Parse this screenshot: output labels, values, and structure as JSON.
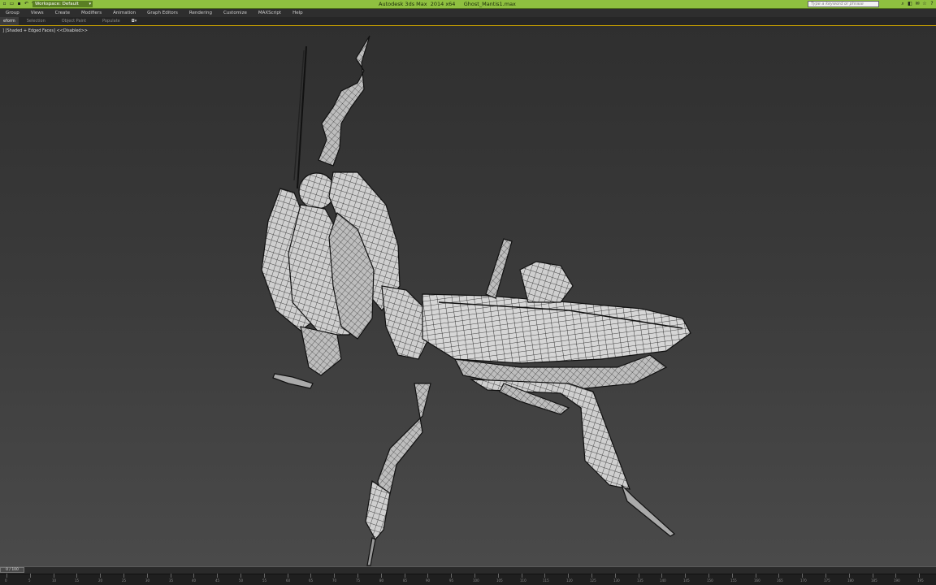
{
  "titlebar": {
    "workspace": "Workspace: Default",
    "app_title": "Autodesk 3ds Max  2014 x64     Ghost_Mantis1.max",
    "search_placeholder": "Type a keyword or phrase",
    "accent": "#8fc040"
  },
  "quick_access": [
    "new-file-icon",
    "open-icon",
    "save-icon",
    "undo-icon",
    "redo-icon",
    "project-icon"
  ],
  "titlebar_icons": [
    "search-icon",
    "subscription-icon",
    "communication-icon",
    "favorites-icon",
    "help-icon"
  ],
  "menu": [
    "Group",
    "Views",
    "Create",
    "Modifiers",
    "Animation",
    "Graph Editors",
    "Rendering",
    "Customize",
    "MAXScript",
    "Help"
  ],
  "ribbon": {
    "tabs": [
      "eform",
      "Selection",
      "Object Paint",
      "Populate"
    ]
  },
  "viewport": {
    "label": "] [Shaded + Edged Faces]  <<Disabled>>"
  },
  "timeline": {
    "slider": "0 / 100",
    "ticks": [
      "0",
      "5",
      "10",
      "15",
      "20",
      "25",
      "30",
      "35",
      "40",
      "45",
      "50",
      "55",
      "60",
      "65",
      "70",
      "75",
      "80",
      "85",
      "90",
      "95",
      "100",
      "105",
      "110",
      "115",
      "120",
      "125",
      "130",
      "135",
      "140",
      "145",
      "150",
      "155",
      "160",
      "165",
      "170",
      "175",
      "180",
      "185",
      "190",
      "195"
    ]
  }
}
